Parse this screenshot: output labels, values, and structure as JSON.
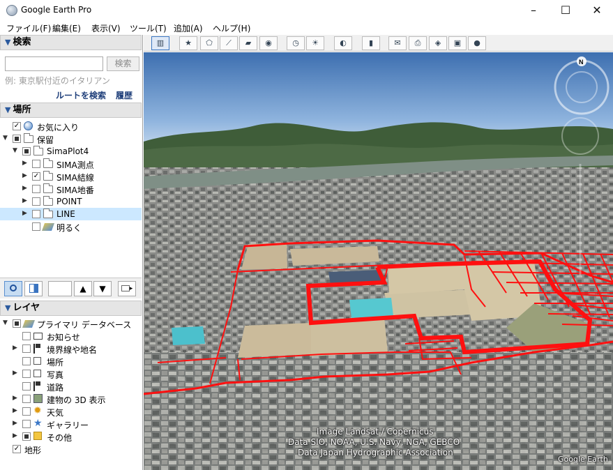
{
  "window": {
    "title": "Google Earth Pro",
    "minimize": "–",
    "maximize": "☐",
    "close": "✕"
  },
  "menu": [
    "ファイル(F)",
    "編集(E)",
    "表示(V)",
    "ツール(T)",
    "追加(A)",
    "ヘルプ(H)"
  ],
  "search": {
    "header": "検索",
    "input_value": "",
    "button_label": "検索",
    "example": "例: 東京駅付近のイタリアン",
    "route_link": "ルートを検索",
    "history_link": "履歴"
  },
  "places": {
    "header": "場所",
    "items": [
      {
        "label": "お気に入り",
        "state": "checked",
        "icon": "globe-icon",
        "expander": "",
        "depth": 0
      },
      {
        "label": "保留",
        "state": "partial",
        "icon": "folder-open-icon",
        "expander": "▼",
        "depth": 0
      },
      {
        "label": "SimaPlot4",
        "state": "partial",
        "icon": "folder-open-icon",
        "expander": "▼",
        "depth": 1
      },
      {
        "label": "SIMA測点",
        "state": "unchecked",
        "icon": "folder-icon",
        "expander": "▶",
        "depth": 2
      },
      {
        "label": "SIMA結線",
        "state": "checked",
        "icon": "folder-icon",
        "expander": "▶",
        "depth": 2
      },
      {
        "label": "SIMA地番",
        "state": "unchecked",
        "icon": "folder-icon",
        "expander": "▶",
        "depth": 2
      },
      {
        "label": "POINT",
        "state": "unchecked",
        "icon": "folder-icon",
        "expander": "▶",
        "depth": 2
      },
      {
        "label": "LINE",
        "state": "unchecked",
        "icon": "folder-icon",
        "expander": "▶",
        "depth": 2,
        "selected": true
      },
      {
        "label": "明るく",
        "state": "unchecked",
        "icon": "layers-icon",
        "expander": "",
        "depth": 2
      }
    ],
    "tools": {
      "up": "▲",
      "down": "▼",
      "folder": "▸"
    }
  },
  "layers": {
    "header": "レイヤ",
    "items": [
      {
        "label": "プライマリ データベース",
        "state": "partial",
        "icon": "database-icon",
        "expander": "▼",
        "depth": 0
      },
      {
        "label": "お知らせ",
        "state": "unchecked",
        "icon": "mail-icon",
        "expander": "",
        "depth": 1
      },
      {
        "label": "境界線や地名",
        "state": "unchecked",
        "icon": "flag-icon",
        "expander": "▶",
        "depth": 1
      },
      {
        "label": "場所",
        "state": "unchecked",
        "icon": "square-icon",
        "expander": "",
        "depth": 1
      },
      {
        "label": "写真",
        "state": "unchecked",
        "icon": "square-icon",
        "expander": "▶",
        "depth": 1
      },
      {
        "label": "道路",
        "state": "unchecked",
        "icon": "road-icon",
        "expander": "",
        "depth": 1
      },
      {
        "label": "建物の 3D 表示",
        "state": "unchecked",
        "icon": "building-icon",
        "expander": "▶",
        "depth": 1
      },
      {
        "label": "天気",
        "state": "unchecked",
        "icon": "sun-icon",
        "expander": "▶",
        "depth": 1
      },
      {
        "label": "ギャラリー",
        "state": "unchecked",
        "icon": "star-icon",
        "expander": "▶",
        "depth": 1
      },
      {
        "label": "その他",
        "state": "partial",
        "icon": "note-icon",
        "expander": "▶",
        "depth": 1
      },
      {
        "label": "地形",
        "state": "checked",
        "icon": "",
        "expander": "",
        "depth": 0
      }
    ]
  },
  "toolbar": [
    {
      "name": "sidebar-toggle-button",
      "icon": "sidebar-icon",
      "glyph": "▥",
      "active": true
    },
    {
      "name": "add-placemark-button",
      "icon": "pushpin-icon",
      "glyph": "★"
    },
    {
      "name": "add-polygon-button",
      "icon": "polygon-icon",
      "glyph": "⬠"
    },
    {
      "name": "add-path-button",
      "icon": "path-icon",
      "glyph": "⟋"
    },
    {
      "name": "add-overlay-button",
      "icon": "overlay-icon",
      "glyph": "▰"
    },
    {
      "name": "record-tour-button",
      "icon": "camera-icon",
      "glyph": "◉"
    },
    {
      "name": "historical-imagery-button",
      "icon": "clock-icon",
      "glyph": "◷"
    },
    {
      "name": "sunlight-button",
      "icon": "sun-icon",
      "glyph": "☀"
    },
    {
      "name": "switch-planet-button",
      "icon": "planet-icon",
      "glyph": "◐"
    },
    {
      "name": "ruler-button",
      "icon": "ruler-icon",
      "glyph": "▮"
    },
    {
      "name": "email-button",
      "icon": "mail-icon",
      "glyph": "✉"
    },
    {
      "name": "print-button",
      "icon": "print-icon",
      "glyph": "⎙"
    },
    {
      "name": "view-in-maps-button",
      "icon": "maps-icon",
      "glyph": "◈"
    },
    {
      "name": "save-image-button",
      "icon": "image-icon",
      "glyph": "▣"
    },
    {
      "name": "earth-community-button",
      "icon": "globe-icon",
      "glyph": "●"
    }
  ],
  "map": {
    "compass_label": "N",
    "attribution": [
      "Image Landsat / Copernicus",
      "Data SIO, NOAA, U.S. Navy, NGA, GEBCO",
      "Data Japan Hydrographic Association"
    ],
    "watermark": "Google Earth",
    "line_color": "#ff1010"
  }
}
